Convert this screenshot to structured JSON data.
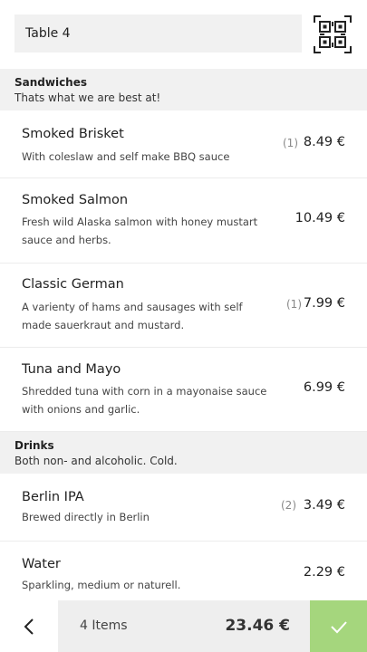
{
  "header": {
    "table_value": "Table 4",
    "qr_icon": "qr-code-scan-icon"
  },
  "sections": [
    {
      "name": "Sandwiches",
      "description": "Thats what we are best at!",
      "items": [
        {
          "title": "Smoked Brisket",
          "description": "With coleslaw and self make BBQ sauce",
          "count": "(1)",
          "price": "8.49 €"
        },
        {
          "title": "Smoked Salmon",
          "description": "Fresh wild Alaska salmon with honey mustart sauce and herbs.",
          "count": "",
          "price": "10.49 €"
        },
        {
          "title": "Classic German",
          "description": "A varienty of hams and sausages with self made sauerkraut and mustard.",
          "count": "(1)",
          "price": "7.99 €"
        },
        {
          "title": "Tuna and Mayo",
          "description": "Shredded tuna with corn in a mayonaise sauce with onions and garlic.",
          "count": "",
          "price": "6.99 €"
        }
      ]
    },
    {
      "name": "Drinks",
      "description": "Both non- and alcoholic. Cold.",
      "items": [
        {
          "title": "Berlin IPA",
          "description": "Brewed directly in Berlin",
          "count": "(2)",
          "price": "3.49 €"
        },
        {
          "title": "Water",
          "description": "Sparkling, medium or naturell.",
          "count": "",
          "price": "2.29 €"
        }
      ]
    }
  ],
  "footer": {
    "back_icon": "chevron-left-icon",
    "items_label": "4 Items",
    "total": "23.46 €",
    "confirm_icon": "checkmark-icon",
    "confirm_color": "#a5d67d"
  }
}
